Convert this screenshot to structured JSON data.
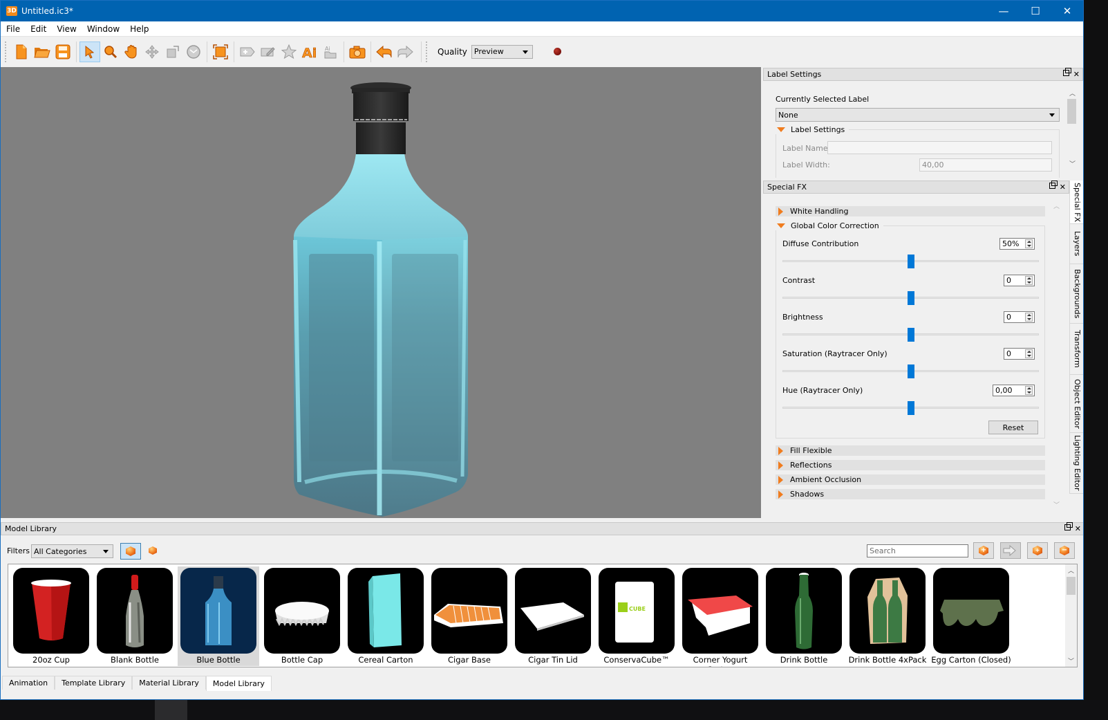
{
  "window": {
    "title": "Untitled.ic3*",
    "app_icon": "3D",
    "controls": {
      "minimize": "—",
      "maximize": "☐",
      "close": "✕"
    }
  },
  "menu": [
    "File",
    "Edit",
    "View",
    "Window",
    "Help"
  ],
  "toolbar": {
    "buttons": [
      {
        "name": "new-file-icon"
      },
      {
        "name": "open-folder-icon"
      },
      {
        "name": "save-icon"
      },
      {
        "name": "select-arrow-icon",
        "active": true
      },
      {
        "name": "zoom-icon"
      },
      {
        "name": "pan-hand-icon"
      },
      {
        "name": "move-icon"
      },
      {
        "name": "scale-icon"
      },
      {
        "name": "rotate-icon"
      },
      {
        "name": "fit-view-icon"
      },
      {
        "name": "add-label-icon"
      },
      {
        "name": "edit-label-icon"
      },
      {
        "name": "star-icon"
      },
      {
        "name": "import-ai-icon"
      },
      {
        "name": "import-file-icon"
      },
      {
        "name": "camera-icon"
      },
      {
        "name": "undo-icon"
      },
      {
        "name": "redo-icon"
      }
    ],
    "quality_label": "Quality",
    "quality_value": "Preview",
    "record_icon": "record-icon"
  },
  "label_settings": {
    "title": "Label Settings",
    "currently_selected_label": "Currently Selected Label",
    "selected_value": "None",
    "section_title": "Label Settings",
    "label_name_label": "Label Name:",
    "label_name_value": "",
    "label_width_label": "Label Width:",
    "label_width_value": "40,00"
  },
  "special_fx": {
    "title": "Special FX",
    "sections_collapsed_top": [
      "White Handling"
    ],
    "expanded_section": "Global Color Correction",
    "controls": [
      {
        "label": "Diffuse Contribution",
        "value": "50%",
        "slider": 0.5
      },
      {
        "label": "Contrast",
        "value": "0",
        "slider": 0.5
      },
      {
        "label": "Brightness",
        "value": "0",
        "slider": 0.5
      },
      {
        "label": "Saturation (Raytracer Only)",
        "value": "0",
        "slider": 0.5
      },
      {
        "label": "Hue (Raytracer Only)",
        "value": "0,00",
        "slider": 0.5
      }
    ],
    "reset_label": "Reset",
    "sections_collapsed_bottom": [
      "Fill Flexible",
      "Reflections",
      "Ambient Occlusion",
      "Shadows"
    ]
  },
  "side_tabs": [
    "Special FX",
    "Layers",
    "Backgrounds",
    "Transform",
    "Object Editor",
    "Lighting Editor"
  ],
  "model_library": {
    "title": "Model Library",
    "filters_label": "Filters",
    "category": "All Categories",
    "search_placeholder": "Search",
    "items": [
      {
        "label": "20oz Cup"
      },
      {
        "label": "Blank Bottle"
      },
      {
        "label": "Blue Bottle",
        "selected": true
      },
      {
        "label": "Bottle Cap"
      },
      {
        "label": "Cereal Carton"
      },
      {
        "label": "Cigar Base"
      },
      {
        "label": "Cigar Tin Lid"
      },
      {
        "label": "ConservaCube™"
      },
      {
        "label": "Corner Yogurt Carton"
      },
      {
        "label": "Drink Bottle"
      },
      {
        "label": "Drink Bottle 4xPack"
      },
      {
        "label": "Egg Carton (Closed)"
      }
    ]
  },
  "bottom_tabs": [
    {
      "label": "Animation"
    },
    {
      "label": "Template Library"
    },
    {
      "label": "Material Library"
    },
    {
      "label": "Model Library",
      "active": true
    }
  ]
}
